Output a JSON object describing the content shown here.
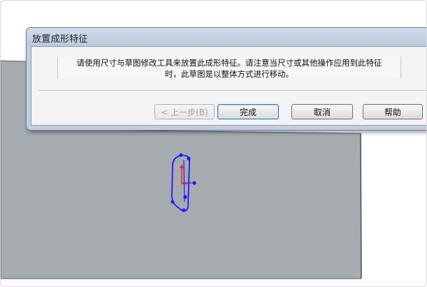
{
  "dialog": {
    "title": "放置成形特征",
    "message_line1": "请使用尺寸与草图修改工具来放置此成形特征。请注意当尺寸或其他操作应用到此特征",
    "message_line2": "时，此草图是以整体方式进行移动。",
    "buttons": {
      "back": "< 上一步(B)",
      "finish": "完成",
      "cancel": "取消",
      "help": "帮助"
    },
    "back_enabled": false
  },
  "colors": {
    "part_face": "#a6abb0",
    "sketch_blue": "#1a1aff",
    "origin_red": "#ff2020",
    "dialog_frame": "#bfcfe0",
    "dialog_client": "#f3f3f3"
  },
  "icons": {
    "sketch_profile": "sketch-profile-icon",
    "origin_marker": "origin-marker-icon"
  }
}
